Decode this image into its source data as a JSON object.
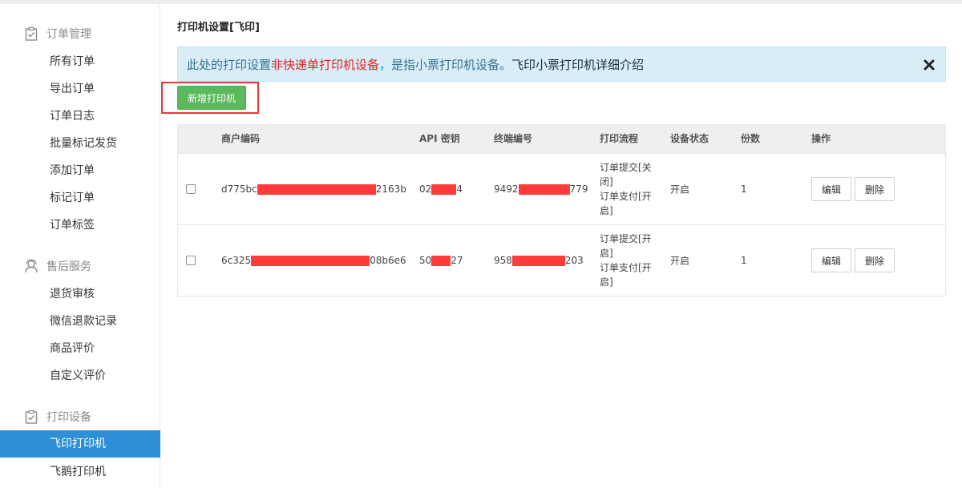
{
  "sidebar": {
    "groups": [
      {
        "title": "订单管理",
        "icon": "clipboard-check-icon",
        "items": [
          "所有订单",
          "导出订单",
          "订单日志",
          "批量标记发货",
          "添加订单",
          "标记订单",
          "订单标签"
        ]
      },
      {
        "title": "售后服务",
        "icon": "user-service-icon",
        "items": [
          "退货审核",
          "微信退款记录",
          "商品评价",
          "自定义评价"
        ]
      },
      {
        "title": "打印设备",
        "icon": "clipboard-check-icon",
        "items": [
          "飞印打印机",
          "飞鹅打印机"
        ]
      }
    ],
    "active_item": "飞印打印机"
  },
  "main": {
    "title": "打印机设置[飞印]",
    "alert": {
      "part1": "此处的打印设置",
      "part2_red": "非快递单打印机设备",
      "part3": "，是指小票打印机设备。",
      "part4_dark": "飞印小票打印机详细介绍",
      "close_icon": "close-icon"
    },
    "add_button": "新增打印机",
    "table": {
      "headers": [
        "商户编码",
        "API 密钥",
        "终端编号",
        "打印流程",
        "设备状态",
        "份数",
        "操作"
      ],
      "rows": [
        {
          "merchant_prefix": "d775bc",
          "merchant_suffix": "2163b",
          "api_prefix": "02",
          "api_suffix": "4",
          "terminal_prefix": "9492",
          "terminal_suffix": "779",
          "flow_lines": [
            "订单提交[关",
            "闭]",
            "订单支付[开",
            "启]"
          ],
          "status": "开启",
          "copies": "1",
          "edit": "编辑",
          "delete": "删除"
        },
        {
          "merchant_prefix": "6c325",
          "merchant_suffix": "08b6e6",
          "api_prefix": "50",
          "api_suffix": "27",
          "terminal_prefix": "958",
          "terminal_suffix": "203",
          "flow_lines": [
            "订单提交[开",
            "启]",
            "订单支付[开",
            "启]"
          ],
          "status": "开启",
          "copies": "1",
          "edit": "编辑",
          "delete": "删除"
        }
      ]
    }
  },
  "colors": {
    "active_nav": "#2d8fd5",
    "add_button": "#5cb85c",
    "alert_bg": "#d9edf7",
    "redaction": "#ff3b3b",
    "highlight_frame": "#e23b3b"
  }
}
